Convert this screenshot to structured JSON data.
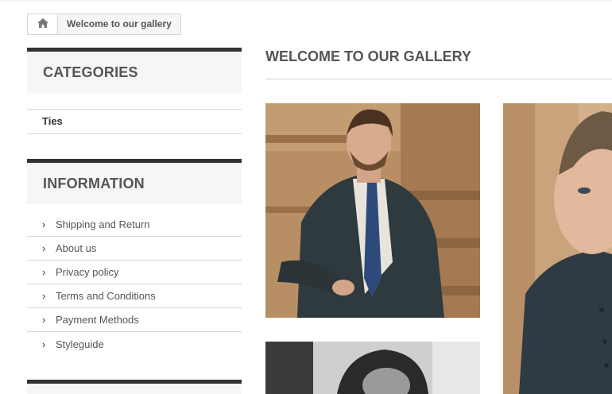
{
  "breadcrumb": {
    "home_icon": "home-icon",
    "current": "Welcome to our gallery"
  },
  "sidebar": {
    "categories": {
      "title": "CATEGORIES",
      "items": [
        {
          "label": "Ties"
        }
      ]
    },
    "information": {
      "title": "INFORMATION",
      "items": [
        {
          "label": "Shipping and Return"
        },
        {
          "label": "About us"
        },
        {
          "label": "Privacy policy"
        },
        {
          "label": "Terms and Conditions"
        },
        {
          "label": "Payment Methods"
        },
        {
          "label": "Styleguide"
        }
      ]
    }
  },
  "main": {
    "title": "WELCOME TO OUR GALLERY"
  },
  "colors": {
    "block_border": "#333333",
    "block_bg": "#f6f6f6",
    "divider": "#d6d4d4"
  }
}
